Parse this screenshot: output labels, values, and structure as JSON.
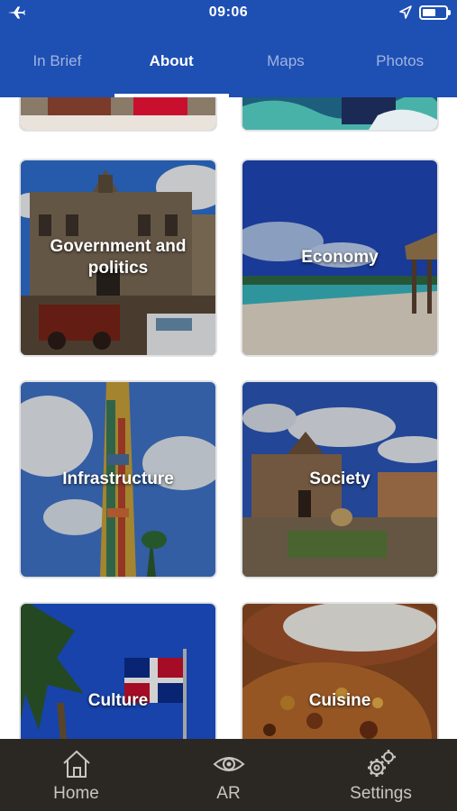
{
  "status_bar": {
    "time": "09:06",
    "airplane_icon": "airplane-icon",
    "location_icon": "location-arrow-icon",
    "battery_icon": "battery-icon"
  },
  "tabs": [
    {
      "label": "In Brief",
      "active": false
    },
    {
      "label": "About",
      "active": true
    },
    {
      "label": "Maps",
      "active": false
    },
    {
      "label": "Photos",
      "active": false
    }
  ],
  "cards": [
    {
      "label": "Government and politics"
    },
    {
      "label": "Economy"
    },
    {
      "label": "Infrastructure"
    },
    {
      "label": "Society"
    },
    {
      "label": "Culture"
    },
    {
      "label": "Cuisine"
    }
  ],
  "bottom_nav": [
    {
      "label": "Home",
      "icon": "home-icon"
    },
    {
      "label": "AR",
      "icon": "eye-icon"
    },
    {
      "label": "Settings",
      "icon": "gears-icon"
    }
  ],
  "colors": {
    "header": "#1e4fb3",
    "tab_inactive": "#9fb4e0",
    "bottom_bar": "#2b2723"
  }
}
